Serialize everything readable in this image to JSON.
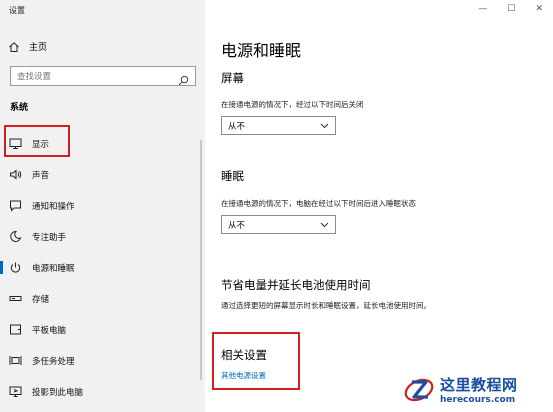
{
  "window": {
    "title": "设置",
    "controls": {
      "minimize": "—",
      "maximize": "☐",
      "close": "✕"
    }
  },
  "sidebar": {
    "home_label": "主页",
    "search_placeholder": "查找设置",
    "section_label": "系统",
    "items": [
      {
        "label": "显示",
        "icon": "monitor-icon"
      },
      {
        "label": "声音",
        "icon": "speaker-icon"
      },
      {
        "label": "通知和操作",
        "icon": "notification-icon"
      },
      {
        "label": "专注助手",
        "icon": "moon-icon"
      },
      {
        "label": "电源和睡眠",
        "icon": "power-icon",
        "active": true
      },
      {
        "label": "存储",
        "icon": "storage-icon"
      },
      {
        "label": "平板电脑",
        "icon": "tablet-icon"
      },
      {
        "label": "多任务处理",
        "icon": "multitask-icon"
      },
      {
        "label": "投影到此电脑",
        "icon": "project-icon"
      }
    ]
  },
  "main": {
    "title": "电源和睡眠",
    "screen": {
      "heading": "屏幕",
      "description": "在接通电源的情况下，经过以下时间后关闭",
      "value": "从不"
    },
    "sleep": {
      "heading": "睡眠",
      "description": "在接通电源的情况下，电脑在经过以下时间后进入睡眠状态",
      "value": "从不"
    },
    "battery": {
      "heading": "节省电量并延长电池使用时间",
      "description": "通过选择更短的屏幕显示时长和睡眠设置，延长电池使用时间。"
    },
    "related": {
      "heading": "相关设置",
      "link": "其他电源设置"
    }
  },
  "watermark": {
    "cn": "这里教程网",
    "en": "herecours.com"
  },
  "colors": {
    "accent": "#0067c0",
    "highlight": "#d02020",
    "sidebar_bg": "#f1f1f1"
  }
}
